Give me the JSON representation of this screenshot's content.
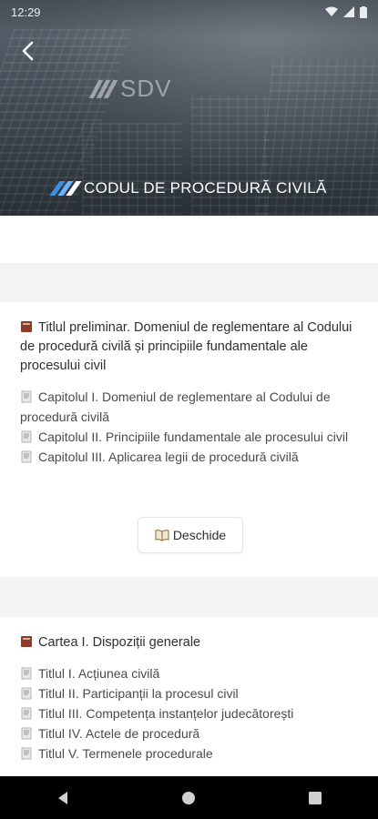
{
  "status": {
    "time": "12:29"
  },
  "header": {
    "logo_text": "SDV",
    "title": "CODUL DE PROCEDURĂ CIVILĂ"
  },
  "card1": {
    "heading": "Titlul preliminar. Domeniul de reglementare al Codului de procedură civilă și principiile fundamentale ale procesului civil",
    "items": [
      "Capitolul I. Domeniul de reglementare al Codului de procedură civilă",
      "Capitolul II. Principiile fundamentale ale procesului civil",
      "Capitolul III. Aplicarea legii de procedură civilă"
    ],
    "button_label": "Deschide"
  },
  "card2": {
    "heading": "Cartea I. Dispoziții generale",
    "items": [
      "Titlul I. Acțiunea civilă",
      "Titlul II. Participanții la procesul civil",
      "Titlul III. Competența instanțelor judecătorești",
      "Titlul IV. Actele de procedură",
      "Titlul V. Termenele procedurale"
    ]
  },
  "icons": {
    "book": "closed-book-icon",
    "page": "page-icon",
    "open": "open-book-icon"
  }
}
